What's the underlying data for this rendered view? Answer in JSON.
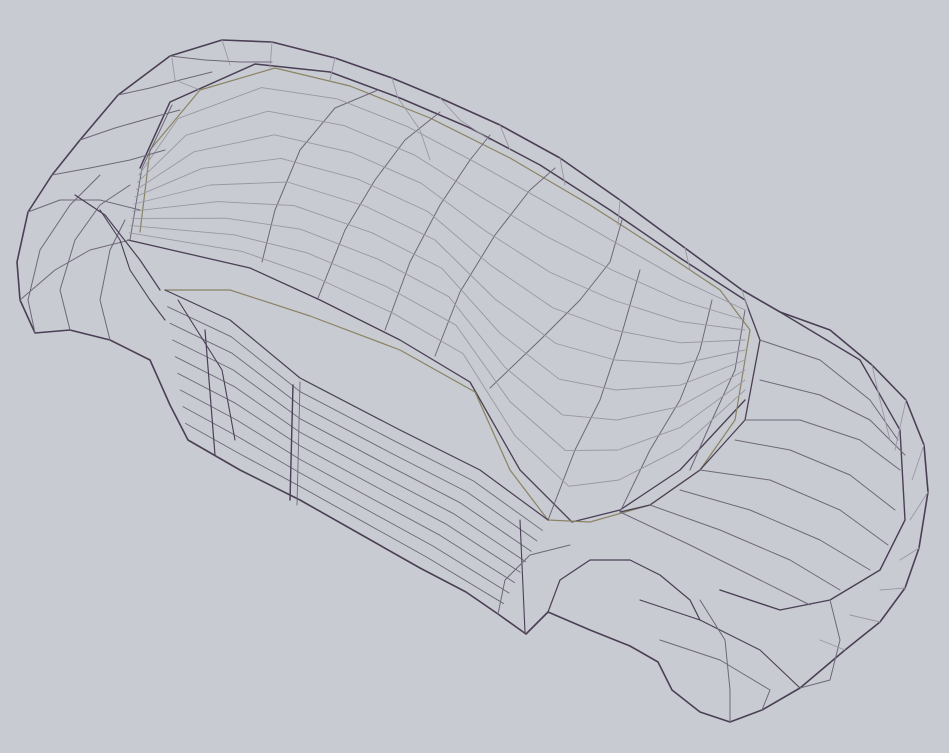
{
  "viewport": {
    "background_color": "#c9cbd2",
    "wire_color_dark": "#4a3f55",
    "wire_color_mid": "#6e6879",
    "wire_color_light": "#9a97a4",
    "accent_edge_color": "#8a8464"
  },
  "model": {
    "subject": "car-body-wireframe",
    "style": "wireframe"
  }
}
